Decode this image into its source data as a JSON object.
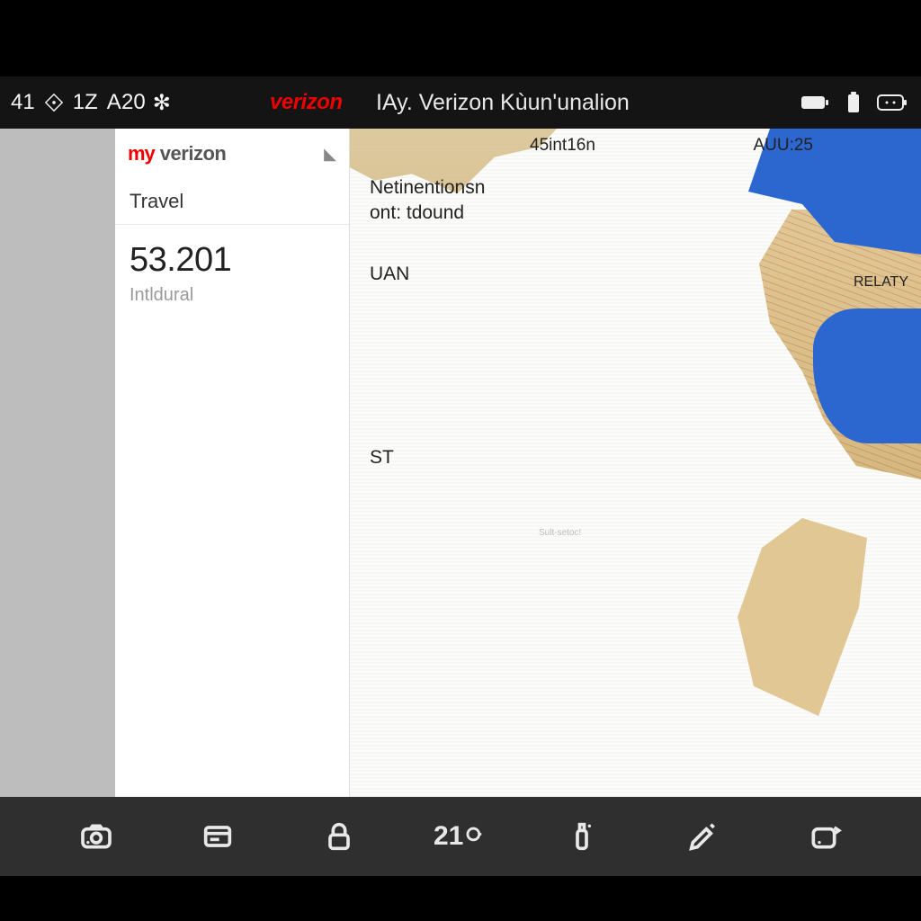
{
  "status": {
    "left_num": "41",
    "left_num2": "1Z",
    "left_glyph": "A",
    "net_num": "20",
    "net_glyph": "✻",
    "carrier_logo": "verizon",
    "title": "IAy. Verizon Kùun'unalion"
  },
  "sidebar": {
    "logo_my": "my",
    "logo_vz": "verizon",
    "chevron": "◣",
    "travel": "Travel",
    "big_number": "53.201",
    "sub_label": "Intldural"
  },
  "map": {
    "top_left": "45int16n",
    "top_right": "AUU:25",
    "line1": "Netinentionsn",
    "line2": "ont: tdound",
    "uan": "UAN",
    "st": "ST",
    "small": "Sult-setoc!",
    "relay": "RELATY"
  },
  "bottombar": {
    "num_label": "21"
  }
}
